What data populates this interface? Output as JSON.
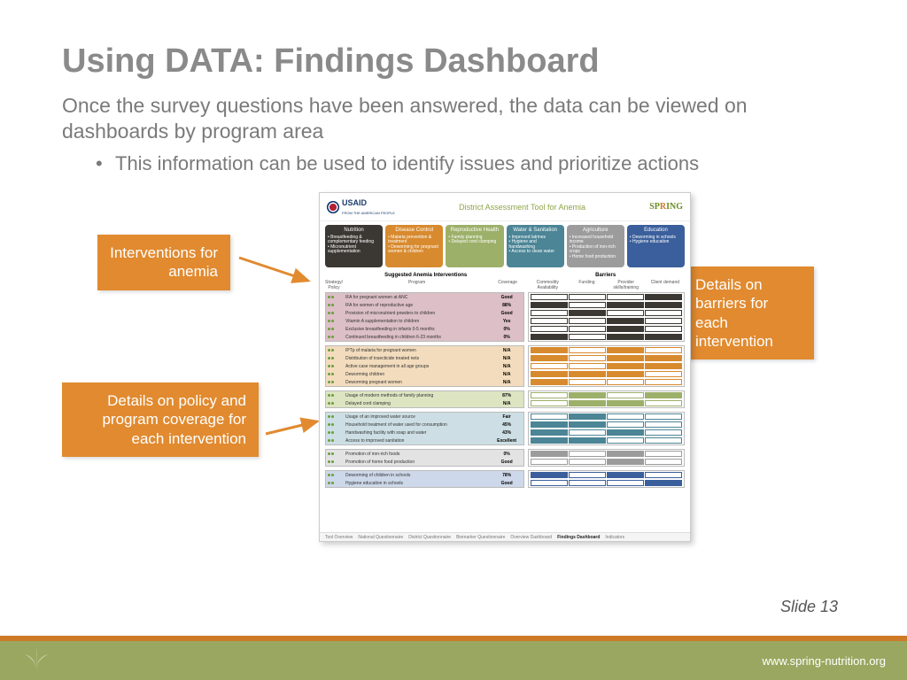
{
  "title": "Using DATA: Findings Dashboard",
  "lead": "Once the survey questions have been answered, the data can be viewed on dashboards by program area",
  "bullet": "This information can be used to identify issues and prioritize actions",
  "callouts": {
    "interventions": "Interventions for anemia",
    "coverage": "Details on policy and program coverage for each intervention",
    "barriers": "Details on barriers for each intervention"
  },
  "slide_label": "Slide 13",
  "footer_url": "www.spring-nutrition.org",
  "dash": {
    "usaid": "USAID",
    "usaid_sub": "FROM THE AMERICAN PEOPLE",
    "title": "District Assessment Tool for Anemia",
    "spring": "SPRING",
    "tiles": [
      {
        "name": "Nutrition",
        "color": "#3b3833",
        "items": [
          "Breastfeeding & complementary feeding",
          "Micronutrient supplementation"
        ]
      },
      {
        "name": "Disease Control",
        "color": "#d88a2e",
        "items": [
          "Malaria prevention & treatment",
          "Deworming for pregnant women & children"
        ]
      },
      {
        "name": "Reproductive Health",
        "color": "#9db06a",
        "items": [
          "Family planning",
          "Delayed cord clamping"
        ]
      },
      {
        "name": "Water & Sanitation",
        "color": "#4b8596",
        "items": [
          "Improved latrines",
          "Hygiene and handwashing",
          "Access to clean water"
        ]
      },
      {
        "name": "Agriculture",
        "color": "#9c9c9c",
        "items": [
          "Increased household income",
          "Production of iron-rich crops",
          "Home food production"
        ]
      },
      {
        "name": "Education",
        "color": "#3a5f9c",
        "items": [
          "Deworming in schools",
          "Hygiene education"
        ]
      }
    ],
    "section_left": "Suggested Anemia Interventions",
    "section_right": "Barriers",
    "col_left": [
      "Strategy/ Policy",
      "Program",
      "Coverage"
    ],
    "col_right": [
      "Commodity Availability",
      "Funding",
      "Provider skills/training",
      "Client demand"
    ],
    "groups": [
      {
        "bg": "#dcbfc7",
        "bar": "#3b3833",
        "rows": [
          {
            "p": "IFA for pregnant women at ANC",
            "c": "Good"
          },
          {
            "p": "IFA for women of reproductive age",
            "c": "88%"
          },
          {
            "p": "Provision of micronutrient powders to children",
            "c": "Good"
          },
          {
            "p": "Vitamin A supplementation to children",
            "c": "Yes"
          },
          {
            "p": "Exclusive breastfeeding in infants 0-5 months",
            "c": "0%"
          },
          {
            "p": "Continued breastfeeding in children 6-23 months",
            "c": "0%"
          }
        ]
      },
      {
        "bg": "#f2dcbd",
        "bar": "#d88a2e",
        "rows": [
          {
            "p": "IPTp of malaria for pregnant women",
            "c": "N/A"
          },
          {
            "p": "Distribution of insecticide treated nets",
            "c": "N/A"
          },
          {
            "p": "Active case management in all age groups",
            "c": "N/A"
          },
          {
            "p": "Deworming children",
            "c": "N/A"
          },
          {
            "p": "Deworming pregnant women",
            "c": "N/A"
          }
        ]
      },
      {
        "bg": "#dde4c1",
        "bar": "#9db06a",
        "rows": [
          {
            "p": "Usage of modern methods of family planning",
            "c": "87%"
          },
          {
            "p": "Delayed cord clamping",
            "c": "N/A"
          }
        ]
      },
      {
        "bg": "#cddfe4",
        "bar": "#4b8596",
        "rows": [
          {
            "p": "Usage of an improved water source",
            "c": "Fair"
          },
          {
            "p": "Household treatment of water used for consumption",
            "c": "45%"
          },
          {
            "p": "Handwashing facility with soap and water",
            "c": "43%"
          },
          {
            "p": "Access to improved sanitation",
            "c": "Excellent"
          }
        ]
      },
      {
        "bg": "#e3e3e3",
        "bar": "#9c9c9c",
        "rows": [
          {
            "p": "Promotion of iron-rich foods",
            "c": "0%"
          },
          {
            "p": "Promotion of home food production",
            "c": "Good"
          }
        ]
      },
      {
        "bg": "#cdd8ea",
        "bar": "#3a5f9c",
        "rows": [
          {
            "p": "Deworming of children in schools",
            "c": "78%"
          },
          {
            "p": "Hygiene education in schools",
            "c": "Good"
          }
        ]
      }
    ],
    "tabs": [
      "Tool Overview",
      "National Questionnaire",
      "District Questionnaire",
      "Biomarker Questionnaire",
      "Overview Dashboard",
      "Findings Dashboard",
      "Indicators"
    ]
  }
}
